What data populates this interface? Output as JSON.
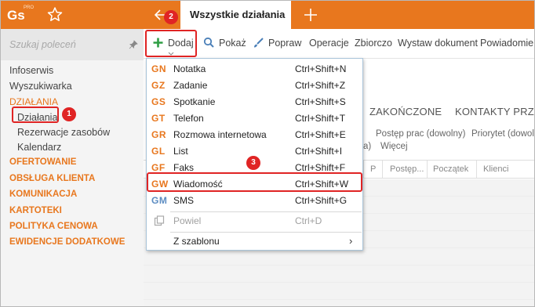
{
  "app": {
    "logo": "Gs",
    "logo_badge": "PRO",
    "active_tab": "Wszystkie działania"
  },
  "sidebar": {
    "search_placeholder": "Szukaj poleceń",
    "items": [
      {
        "label": "Infoserwis"
      },
      {
        "label": "Wyszukiwarka"
      },
      {
        "label": "DZIAŁANIA"
      },
      {
        "label": "Działania"
      },
      {
        "label": "Rezerwacje zasobów"
      },
      {
        "label": "Kalendarz"
      },
      {
        "label": "OFERTOWANIE"
      },
      {
        "label": "OBSŁUGA KLIENTA"
      },
      {
        "label": "KOMUNIKACJA"
      },
      {
        "label": "KARTOTEKI"
      },
      {
        "label": "POLITYKA CENOWA"
      },
      {
        "label": "EWIDENCJE DODATKOWE"
      }
    ]
  },
  "toolbar": {
    "add": "Dodaj",
    "show": "Pokaż",
    "edit": "Popraw",
    "operations": "Operacje",
    "collective": "Zbiorczo",
    "issue_document": "Wystaw dokument",
    "notifications": "Powiadomieni"
  },
  "main": {
    "tabs": [
      "ZAKOŃCZONE",
      "KONTAKTY PRZYC"
    ],
    "filters": [
      "Postęp prac (dowolny)",
      "Priorytet (dowol",
      "a)",
      "Więcej"
    ],
    "columns": [
      "P",
      "Postęp...",
      "Początek",
      "Klienci"
    ]
  },
  "menu": {
    "items": [
      {
        "code": "GN",
        "label": "Notatka",
        "shortcut": "Ctrl+Shift+N"
      },
      {
        "code": "GZ",
        "label": "Zadanie",
        "shortcut": "Ctrl+Shift+Z"
      },
      {
        "code": "GS",
        "label": "Spotkanie",
        "shortcut": "Ctrl+Shift+S"
      },
      {
        "code": "GT",
        "label": "Telefon",
        "shortcut": "Ctrl+Shift+T"
      },
      {
        "code": "GR",
        "label": "Rozmowa internetowa",
        "shortcut": "Ctrl+Shift+E"
      },
      {
        "code": "GL",
        "label": "List",
        "shortcut": "Ctrl+Shift+I"
      },
      {
        "code": "GF",
        "label": "Faks",
        "shortcut": "Ctrl+Shift+F"
      },
      {
        "code": "GW",
        "label": "Wiadomość",
        "shortcut": "Ctrl+Shift+W"
      },
      {
        "code": "GM",
        "label": "SMS",
        "shortcut": "Ctrl+Shift+G"
      }
    ],
    "split": {
      "label": "Powiel",
      "shortcut": "Ctrl+D"
    },
    "template": {
      "label": "Z szablonu",
      "arrow": "›"
    }
  },
  "badges": [
    "1",
    "2",
    "3"
  ],
  "colors": {
    "accent": "#e8771e",
    "highlight": "#e02424"
  }
}
